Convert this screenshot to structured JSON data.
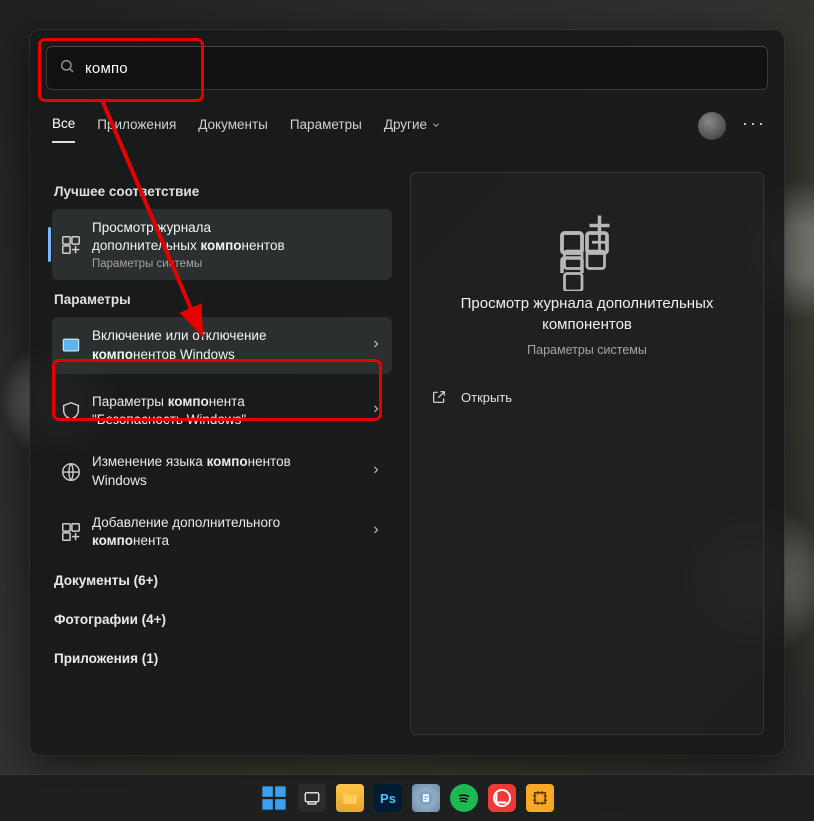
{
  "search": {
    "query": "компо"
  },
  "tabs": {
    "all": "Все",
    "apps": "Приложения",
    "docs": "Документы",
    "settings": "Параметры",
    "more": "Другие"
  },
  "left": {
    "best_match_title": "Лучшее соответствие",
    "best_match": {
      "line1": "Просмотр журнала",
      "line2_pre": "дополнительных ",
      "line2_bold": "компо",
      "line2_post": "нентов",
      "sub": "Параметры системы"
    },
    "settings_title": "Параметры",
    "items": [
      {
        "l1_pre": "Включение или отключение ",
        "l2_bold": "компо",
        "l2_post": "нентов Windows"
      },
      {
        "l1_pre": "Параметры ",
        "l1_bold": "компо",
        "l1_post": "нента ",
        "l2_plain": "\"Безопасность Windows\""
      },
      {
        "l1_pre": "Изменение языка ",
        "l1_bold": "компо",
        "l1_post": "нентов ",
        "l2_plain": "Windows"
      },
      {
        "l1_pre": "Добавление дополнительного ",
        "l2_bold": "компо",
        "l2_post": "нента"
      }
    ],
    "groups": {
      "docs": "Документы (6+)",
      "photos": "Фотографии (4+)",
      "apps": "Приложения (1)"
    }
  },
  "preview": {
    "title": "Просмотр журнала дополнительных компонентов",
    "sub": "Параметры системы",
    "open": "Открыть"
  }
}
